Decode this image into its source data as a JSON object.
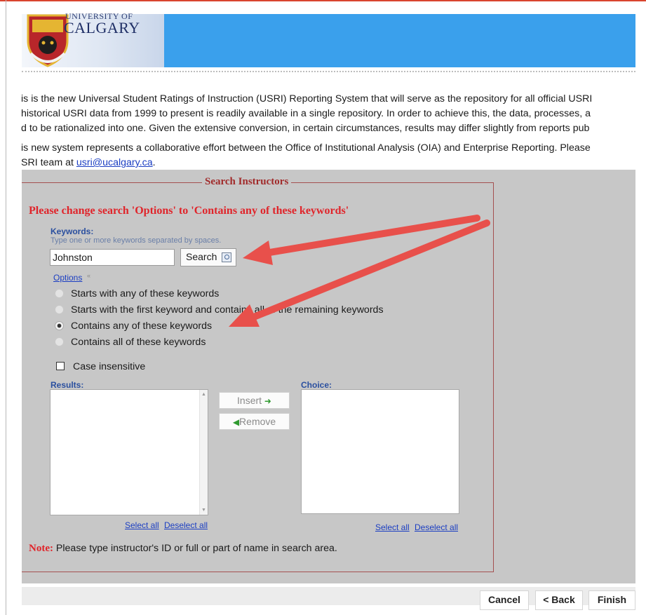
{
  "header": {
    "university_small": "UNIVERSITY OF",
    "university_big": "CALGARY"
  },
  "intro": {
    "lines": [
      "is is the new Universal Student Ratings of Instruction (USRI) Reporting System that will serve as the repository for all official USRI",
      " historical USRI data from 1999 to present is readily available in a single repository.  In order to achieve this, the data, processes, a",
      "d to be rationalized into one.  Given the extensive conversion, in certain circumstances, results may differ slightly from reports pub",
      "is new system represents a collaborative effort between the Office of Institutional Analysis (OIA) and Enterprise Reporting.  Please"
    ],
    "last_prefix": "SRI team at ",
    "email": "usri@ucalgary.ca",
    "last_suffix": "."
  },
  "search_panel": {
    "legend": "Search Instructors",
    "warning": "Please change search 'Options' to 'Contains any of these keywords'",
    "keywords_label": "Keywords:",
    "keywords_hint": "Type one or more keywords separated by spaces.",
    "keyword_value": "Johnston",
    "search_button": "Search",
    "options_link": "Options",
    "options_chevron": "«",
    "radio_options": [
      {
        "label": "Starts with any of these keywords",
        "selected": false
      },
      {
        "label": "Starts with the first keyword and contains all of the remaining keywords",
        "selected": false
      },
      {
        "label": "Contains any of these keywords",
        "selected": true
      },
      {
        "label": "Contains all of these keywords",
        "selected": false
      }
    ],
    "case_insensitive_label": "Case insensitive",
    "case_insensitive_checked": false,
    "results_label": "Results:",
    "choice_label": "Choice:",
    "insert_button": "Insert",
    "remove_button": "Remove",
    "select_all": "Select all",
    "deselect_all": "Deselect all",
    "note_label": "Note:",
    "note_text": " Please type instructor's ID or full or part of name in search area."
  },
  "footer": {
    "cancel": "Cancel",
    "back": "< Back",
    "finish": "Finish"
  },
  "colors": {
    "header_blue": "#3aa0ec",
    "panel_gray": "#c7c7c7",
    "warning_red": "#e0242a",
    "annotation_arrow": "#e8504b"
  }
}
